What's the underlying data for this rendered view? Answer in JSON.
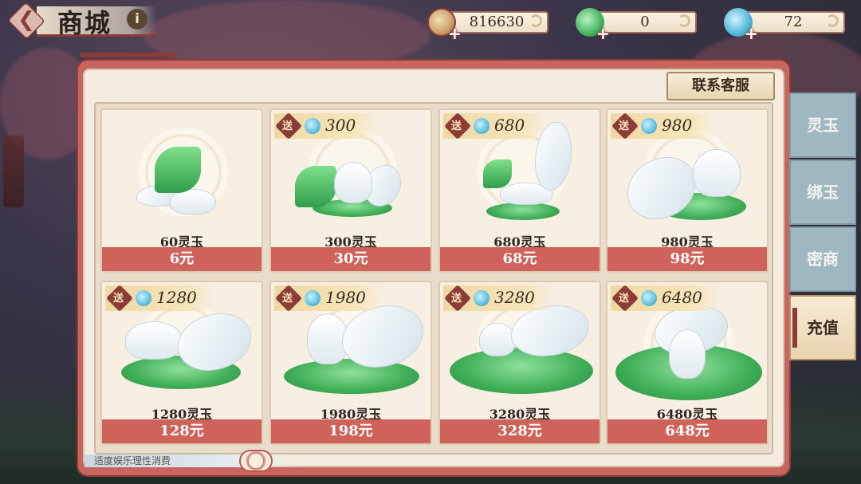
{
  "header": {
    "title": "商城",
    "info_icon": "info-icon",
    "back_icon": "back-arrow-icon"
  },
  "currencies": [
    {
      "icon": "copper-coin-icon",
      "value": "816630",
      "color": "#c9a06a"
    },
    {
      "icon": "green-jade-icon",
      "value": "0",
      "color": "#43b35e"
    },
    {
      "icon": "blue-jade-icon",
      "value": "72",
      "color": "#4fb6d8"
    }
  ],
  "support_button": "联系客服",
  "products": [
    {
      "name": "60灵玉",
      "price": "6元",
      "bonus": ""
    },
    {
      "name": "300灵玉",
      "price": "30元",
      "bonus": "300"
    },
    {
      "name": "680灵玉",
      "price": "68元",
      "bonus": "680"
    },
    {
      "name": "980灵玉",
      "price": "98元",
      "bonus": "980"
    },
    {
      "name": "1280灵玉",
      "price": "128元",
      "bonus": "1280"
    },
    {
      "name": "1980灵玉",
      "price": "198元",
      "bonus": "1980"
    },
    {
      "name": "3280灵玉",
      "price": "328元",
      "bonus": "3280"
    },
    {
      "name": "6480灵玉",
      "price": "648元",
      "bonus": "6480"
    }
  ],
  "bonus_seal": "送",
  "tabs": [
    {
      "label": "灵玉",
      "active": false
    },
    {
      "label": "绑玉",
      "active": false
    },
    {
      "label": "密商",
      "active": false
    },
    {
      "label": "充值",
      "active": true
    }
  ],
  "footer_note": "适度娱乐理性消费"
}
